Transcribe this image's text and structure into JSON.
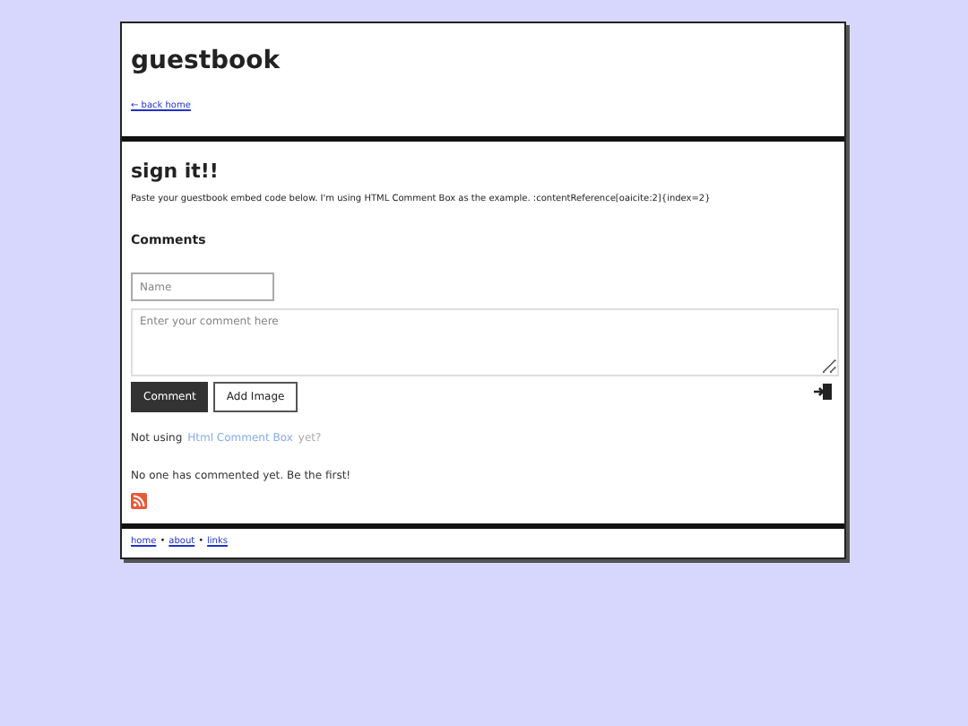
{
  "header": {
    "title": "guestbook",
    "back_link": "← back home"
  },
  "section": {
    "title": "sign it!!",
    "intro": "Paste your guestbook embed code below. I'm using HTML Comment Box as the example. :contentReference[oaicite:2]{index=2}"
  },
  "comments": {
    "heading": "Comments",
    "name": {
      "placeholder": "Name"
    },
    "comment": {
      "placeholder": "Enter your comment here"
    },
    "buttons": [
      "Comment",
      "Add Image"
    ],
    "not_using": {
      "before": "Not using",
      "link": "Html Comment Box",
      "after": "yet?"
    },
    "empty_message": "No one has commented yet. Be the first!"
  },
  "footer": {
    "links": [
      "home",
      "about",
      "links"
    ],
    "separator": "•"
  }
}
